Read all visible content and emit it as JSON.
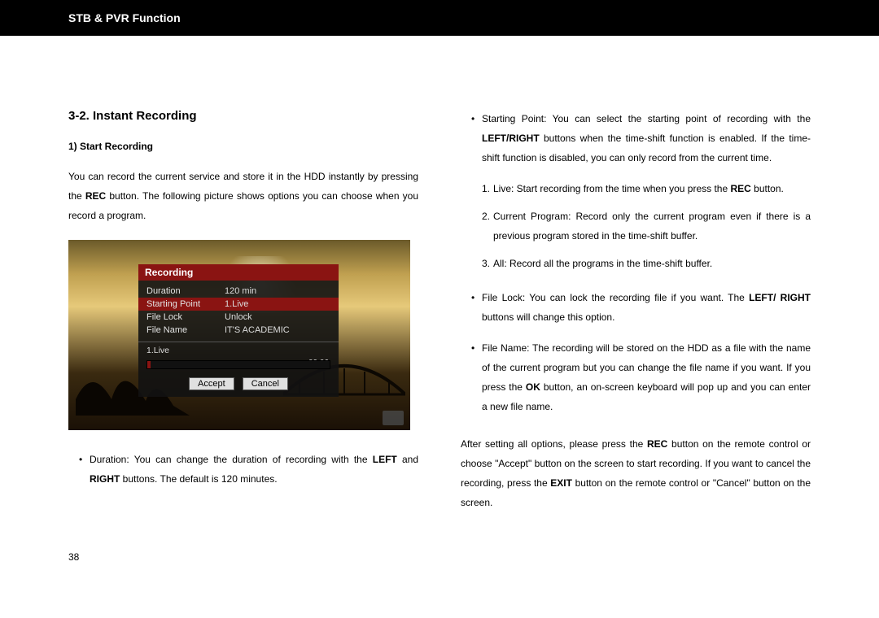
{
  "header": {
    "title": "STB & PVR Function"
  },
  "section": {
    "number_title": "3-2. Instant Recording",
    "sub1": "1) Start Recording",
    "intro_pre": "You can record the current service and store it in the HDD instantly by pressing the ",
    "intro_b1": "REC",
    "intro_post": " button. The following picture shows options you can choose when you record a program."
  },
  "figure": {
    "osd_title": "Recording",
    "rows": [
      {
        "label": "Duration",
        "value": "120 min"
      },
      {
        "label": "Starting Point",
        "value": "1.Live"
      },
      {
        "label": "File Lock",
        "value": "Unlock"
      },
      {
        "label": "File Name",
        "value": "IT'S ACADEMIC"
      }
    ],
    "status_line": "1.Live",
    "time": "00:06",
    "accept": "Accept",
    "cancel": "Cancel"
  },
  "left_bullet": {
    "pre": "Duration: You can change the duration of recording with the ",
    "b1": "LEFT",
    "mid": " and ",
    "b2": "RIGHT",
    "post": " buttons. The default is 120 minutes."
  },
  "right": {
    "sp_pre": "Starting Point: You can select the starting point of recording with the ",
    "sp_b1": "LEFT/RIGHT",
    "sp_post": " buttons when the time-shift function is enabled. If the time-shift function is disabled, you can only record from the current time.",
    "n1_pre": "Live: Start recording from the time when you press the ",
    "n1_b": "REC",
    "n1_post": " button.",
    "n2": "Current Program: Record only the current program even if there is a previous program stored in the time-shift buffer.",
    "n3": "All: Record all the programs in the time-shift buffer.",
    "fl_pre": "File Lock: You can lock the recording file if you want. The ",
    "fl_b": "LEFT/ RIGHT",
    "fl_post": " buttons will change this option.",
    "fn_pre": "File Name: The recording will be stored on the HDD as a file with the name of the current program but you can change the file name if you want. If you press the ",
    "fn_b": "OK",
    "fn_post": " button, an on-screen keyboard will pop up and you can enter a new file name.",
    "closing_1": "After setting all options, please press the ",
    "closing_b1": "REC",
    "closing_2": " button on the remote control or choose \"Accept\" button on the screen to start recording. If you want to cancel the recording, press the ",
    "closing_b2": "EXIT",
    "closing_3": " button on the remote control or \"Cancel\" button on the screen."
  },
  "page_number": "38",
  "labels": {
    "num1": "1.",
    "num2": "2.",
    "num3": "3."
  }
}
